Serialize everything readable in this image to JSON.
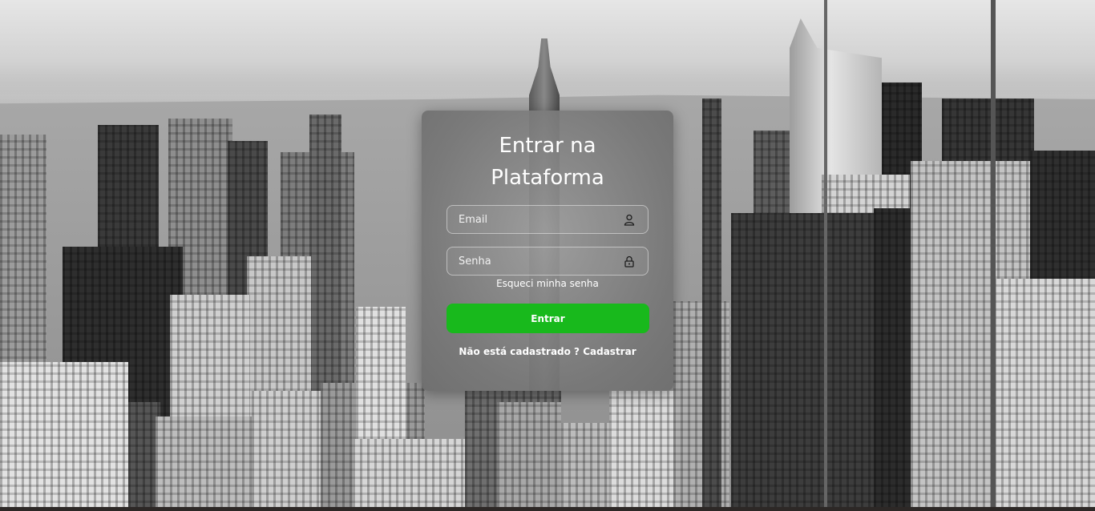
{
  "login": {
    "title_line1": "Entrar na",
    "title_line2": "Plataforma",
    "email": {
      "placeholder": "Email",
      "value": "",
      "icon": "user-icon"
    },
    "password": {
      "placeholder": "Senha",
      "value": "",
      "icon": "lock-icon"
    },
    "forgot_password": "Esqueci minha senha",
    "submit_label": "Entrar",
    "register_prompt": "Não está cadastrado ?",
    "register_link": "Cadastrar"
  },
  "colors": {
    "accent": "#18b91c",
    "text": "#ffffff"
  }
}
